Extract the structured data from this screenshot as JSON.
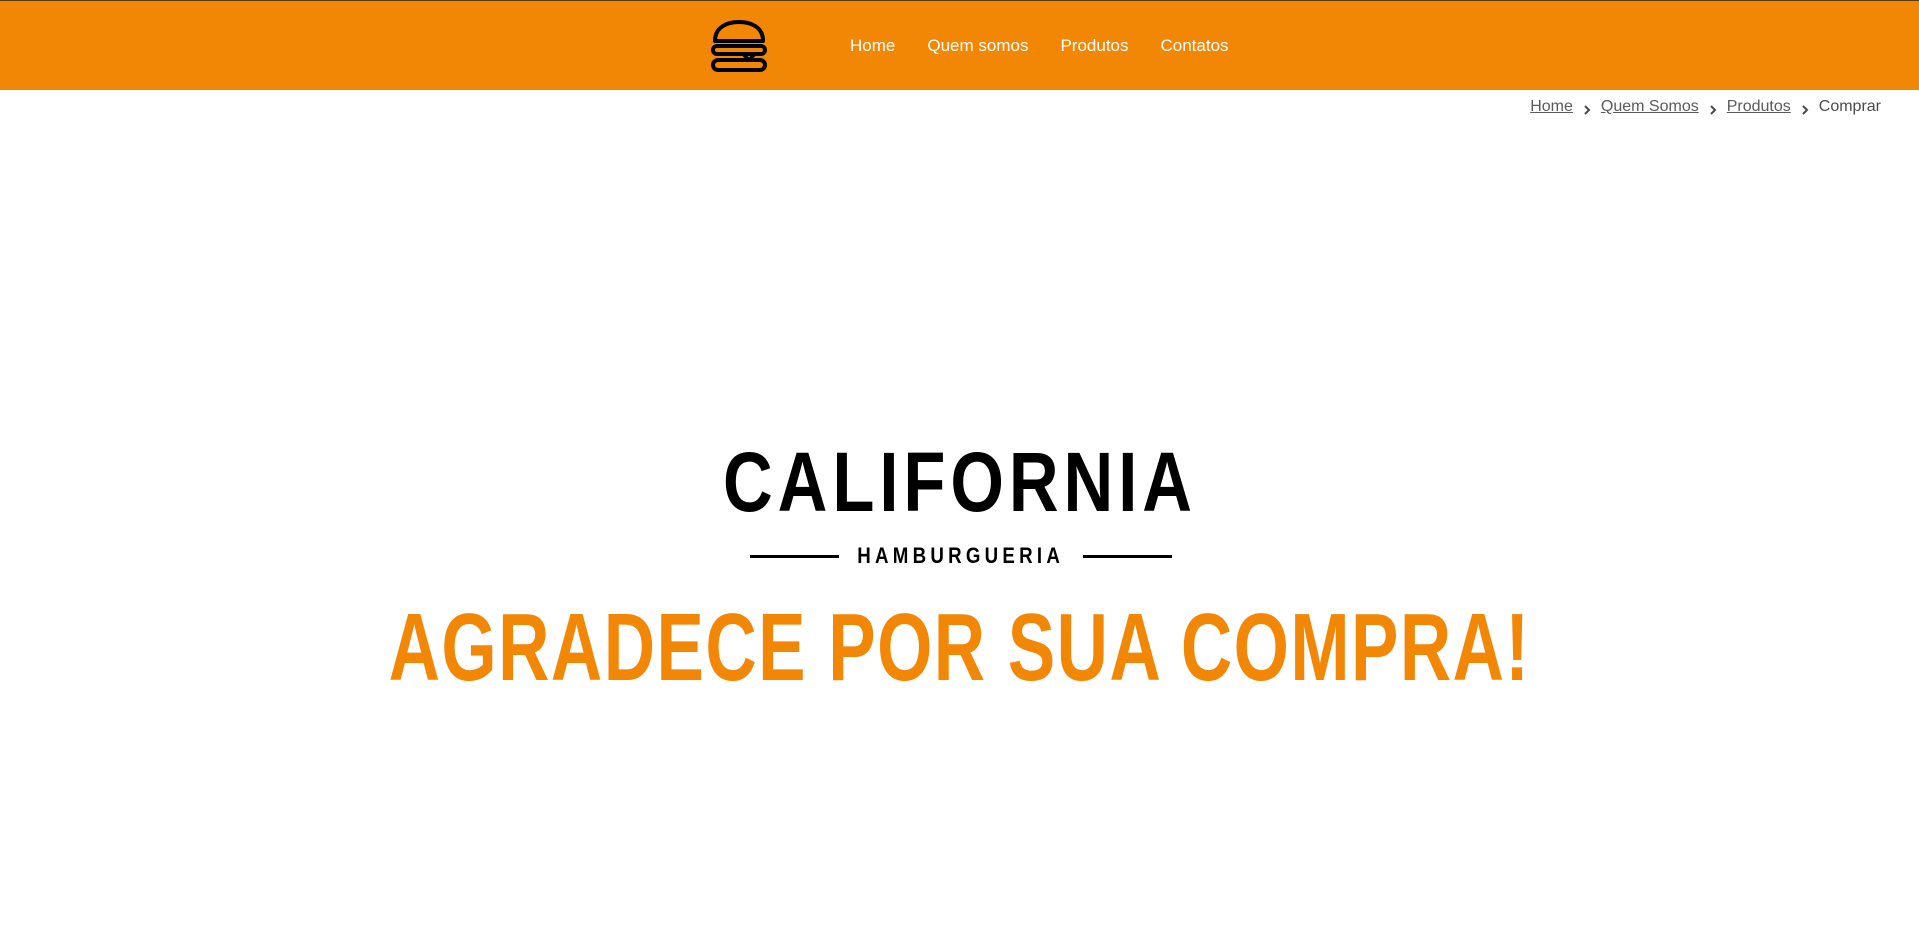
{
  "nav": {
    "logo_icon": "burger-icon",
    "links": [
      {
        "label": "Home"
      },
      {
        "label": "Quem somos"
      },
      {
        "label": "Produtos"
      },
      {
        "label": "Contatos"
      }
    ]
  },
  "breadcrumb": {
    "items": [
      {
        "label": "Home"
      },
      {
        "label": "Quem Somos"
      },
      {
        "label": "Produtos"
      }
    ],
    "current": "Comprar",
    "separator_icon": "chevron-right-icon"
  },
  "brand": {
    "name": "CALIFORNIA",
    "subtitle": "HAMBURGUERIA"
  },
  "message": "AGRADECE POR SUA COMPRA!",
  "colors": {
    "primary": "#f28705",
    "text": "#000000",
    "background": "#ffffff"
  }
}
